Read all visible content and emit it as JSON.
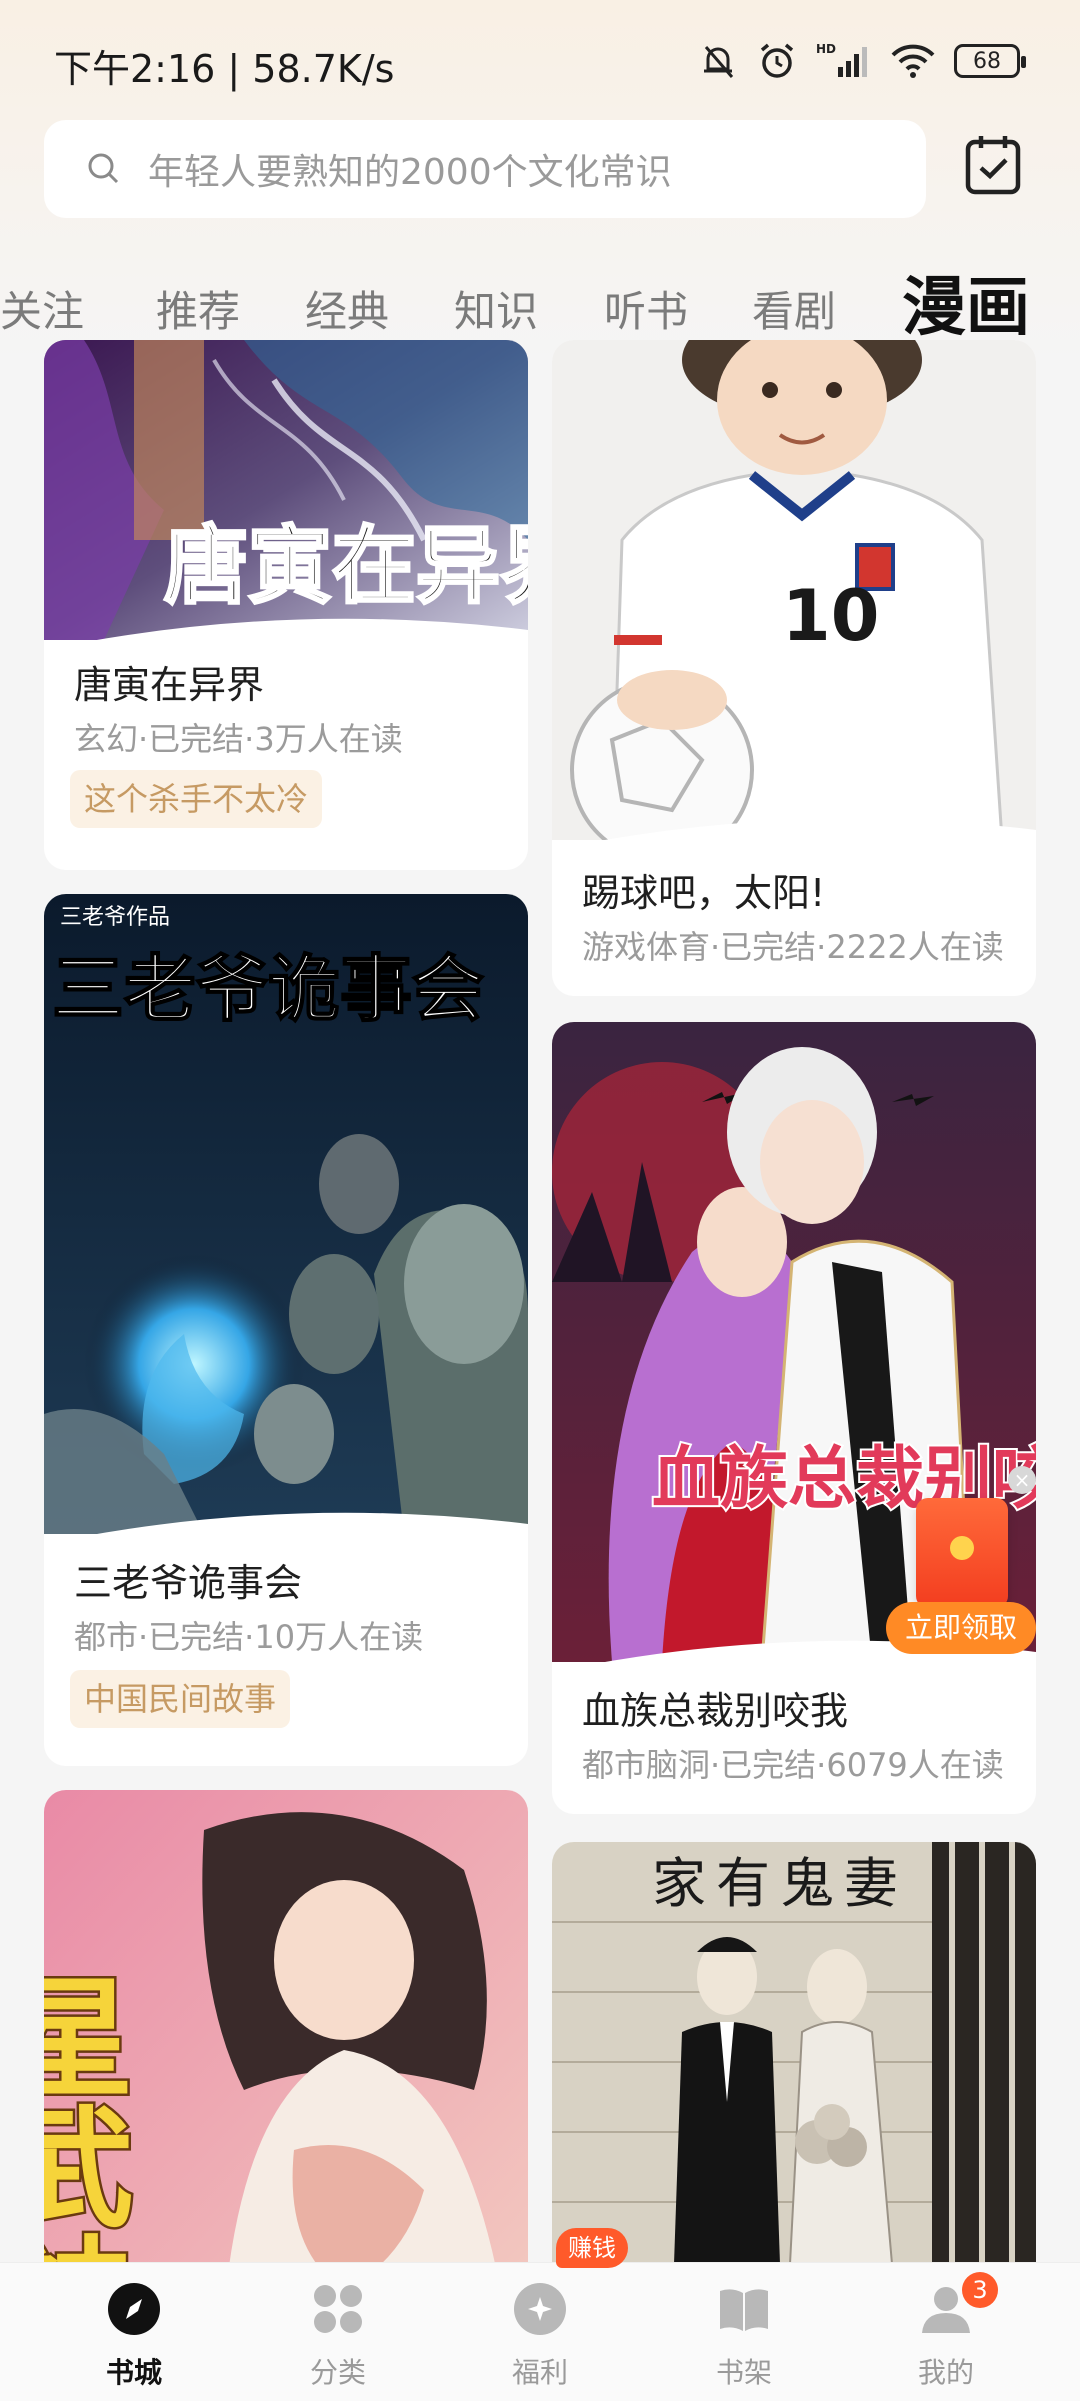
{
  "status_bar": {
    "time": "下午2:16 | 58.7K/s",
    "battery": "68",
    "icons": [
      "mute-bell-icon",
      "alarm-icon",
      "hd-signal-icon",
      "wifi-icon",
      "battery-icon"
    ]
  },
  "search": {
    "placeholder": "年轻人要熟知的2000个文化常识",
    "icon": "search-icon"
  },
  "header": {
    "checkin_icon": "calendar-check-icon"
  },
  "tabs": [
    {
      "label": "关注"
    },
    {
      "label": "推荐"
    },
    {
      "label": "经典"
    },
    {
      "label": "知识"
    },
    {
      "label": "听书"
    },
    {
      "label": "看剧"
    },
    {
      "label": "漫画",
      "active": true
    }
  ],
  "books": [
    {
      "title": "唐寅在异界",
      "meta": "玄幻·已完结·3万人在读",
      "tag": "这个杀手不太冷",
      "cover_text": "唐寅在异界"
    },
    {
      "title": "踢球吧，太阳!",
      "meta": "游戏体育·已完结·2222人在读"
    },
    {
      "title": "三老爷诡事会",
      "meta": "都市·已完结·10万人在读",
      "tag": "中国民间故事",
      "cover_text": "三老爷诡事会",
      "cover_sub": "三老爷作品"
    },
    {
      "title": "血族总裁别咬我",
      "meta": "都市脑洞·已完结·6079人在读",
      "cover_text": "血族总裁别咬我"
    },
    {
      "cover_text": "星武神诀"
    },
    {
      "cover_text": "家有鬼妻"
    }
  ],
  "promo": {
    "label": "立即领取"
  },
  "bottom_nav": [
    {
      "label": "书城",
      "icon": "compass-icon",
      "active": true
    },
    {
      "label": "分类",
      "icon": "grid-icon"
    },
    {
      "label": "福利",
      "icon": "gift-icon",
      "badge": "赚钱"
    },
    {
      "label": "书架",
      "icon": "book-icon"
    },
    {
      "label": "我的",
      "icon": "person-icon",
      "badge": "3"
    }
  ],
  "colors": {
    "accent": "#ff5a2a",
    "tag_bg": "#fbf1e4",
    "tag_text": "#c69a63"
  }
}
